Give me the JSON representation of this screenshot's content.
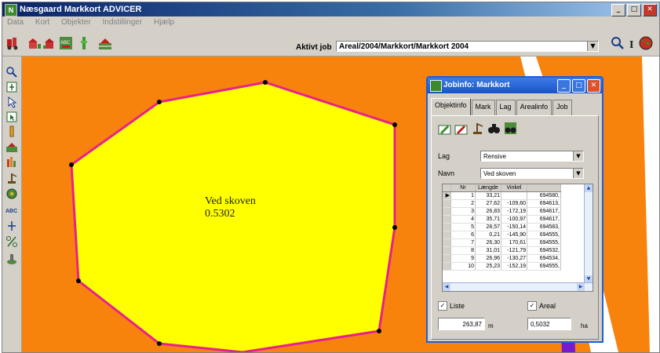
{
  "app": {
    "title": "Næsgaard Markkort ADVICER",
    "menu": [
      "Data",
      "Kort",
      "Objekter",
      "Indstillinger",
      "Hjælp"
    ]
  },
  "toolbar": {
    "active_job_label": "Aktivt job",
    "active_job_value": "Areal/2004/Markkort/Markkort 2004",
    "icons": [
      "tractor-icon",
      "farm-barn-icon",
      "farm-barn-icon",
      "abc-map-icon",
      "green-pin-icon",
      "field-icon"
    ],
    "right_icons": [
      "magnifier-icon",
      "info-icon",
      "globe-icon"
    ]
  },
  "left_tools": [
    "zoom-icon",
    "pan-icon",
    "pointer-icon",
    "select-icon",
    "measure-icon",
    "field-icon",
    "scale-icon",
    "crane-icon",
    "gear-icon",
    "abc-label-icon",
    "cross-tool-icon",
    "percent-icon",
    "paint-icon"
  ],
  "map": {
    "field_name": "Ved skoven",
    "field_area": "0.5302",
    "colors": {
      "background": "#f7830c",
      "field_fill": "#ffff00",
      "field_border": "#e8208e",
      "vertex": "#000000"
    }
  },
  "jobinfo": {
    "title": "Jobinfo: Markkort",
    "tabs": [
      "Objektinfo",
      "Mark",
      "Lag",
      "Arealinfo",
      "Job"
    ],
    "active_tab": "Objektinfo",
    "lag_label": "Lag",
    "lag_value": "Rensive",
    "navn_label": "Navn",
    "navn_value": "Ved skoven",
    "table": {
      "headers": [
        "Nr",
        "Længde",
        "Vinkel",
        ""
      ],
      "rows": [
        [
          "1",
          "33,21",
          "",
          "694580,"
        ],
        [
          "2",
          "27,62",
          "-109,60",
          "694613,"
        ],
        [
          "3",
          "26,83",
          "-172,19",
          "694617,"
        ],
        [
          "4",
          "35,71",
          "-100,97",
          "694617,"
        ],
        [
          "5",
          "28,57",
          "-150,14",
          "694583,"
        ],
        [
          "6",
          "0,21",
          "-145,90",
          "694555,"
        ],
        [
          "7",
          "26,30",
          "170,61",
          "694555,"
        ],
        [
          "8",
          "31,01",
          "-121,79",
          "694532,"
        ],
        [
          "9",
          "26,96",
          "-130,27",
          "694534,"
        ],
        [
          "10",
          "25,23",
          "-152,19",
          "694555,"
        ]
      ]
    },
    "liste_label": "Liste",
    "areal_label": "Areal",
    "length_value": "263,87",
    "length_unit": "m",
    "area_value": "0,5032",
    "area_unit": "ha"
  }
}
